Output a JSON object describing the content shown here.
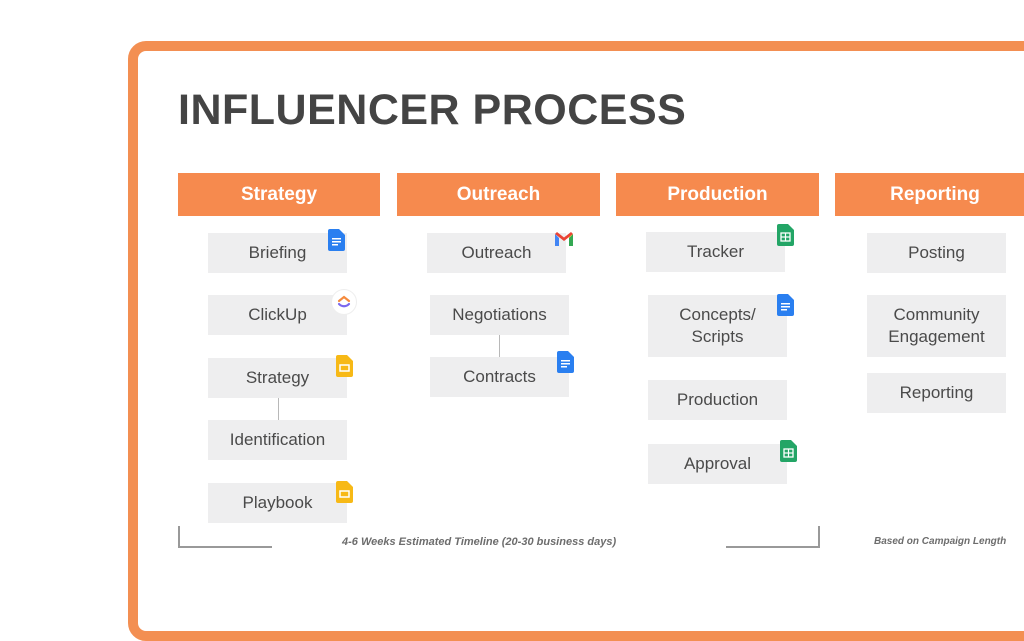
{
  "title": "INFLUENCER PROCESS",
  "columns": [
    {
      "header": "Strategy",
      "items": [
        {
          "label": "Briefing",
          "icon": "google-docs-icon"
        },
        {
          "label": "ClickUp",
          "icon": "clickup-icon"
        },
        {
          "label": "Strategy",
          "icon": "google-slides-icon"
        },
        {
          "label": "Identification",
          "icon": ""
        },
        {
          "label": "Playbook",
          "icon": "google-slides-icon"
        }
      ]
    },
    {
      "header": "Outreach",
      "items": [
        {
          "label": "Outreach",
          "icon": "gmail-icon"
        },
        {
          "label": "Negotiations",
          "icon": ""
        },
        {
          "label": "Contracts",
          "icon": "google-docs-icon"
        }
      ]
    },
    {
      "header": "Production",
      "items": [
        {
          "label": "Tracker",
          "icon": "google-sheets-icon"
        },
        {
          "label": "Concepts/ Scripts",
          "icon": "google-docs-icon"
        },
        {
          "label": "Production",
          "icon": ""
        },
        {
          "label": "Approval",
          "icon": "google-sheets-icon"
        }
      ]
    },
    {
      "header": "Reporting",
      "items": [
        {
          "label": "Posting",
          "icon": ""
        },
        {
          "label": "Community Engagement",
          "icon": ""
        },
        {
          "label": "Reporting",
          "icon": ""
        }
      ]
    }
  ],
  "timeline_note": "4-6 Weeks Estimated Timeline (20-30 business days)",
  "reporting_note": "Based on Campaign Length",
  "colors": {
    "accent": "#f68a4e",
    "frame": "#f38f52",
    "box": "#eeeeef",
    "text": "#444444"
  }
}
